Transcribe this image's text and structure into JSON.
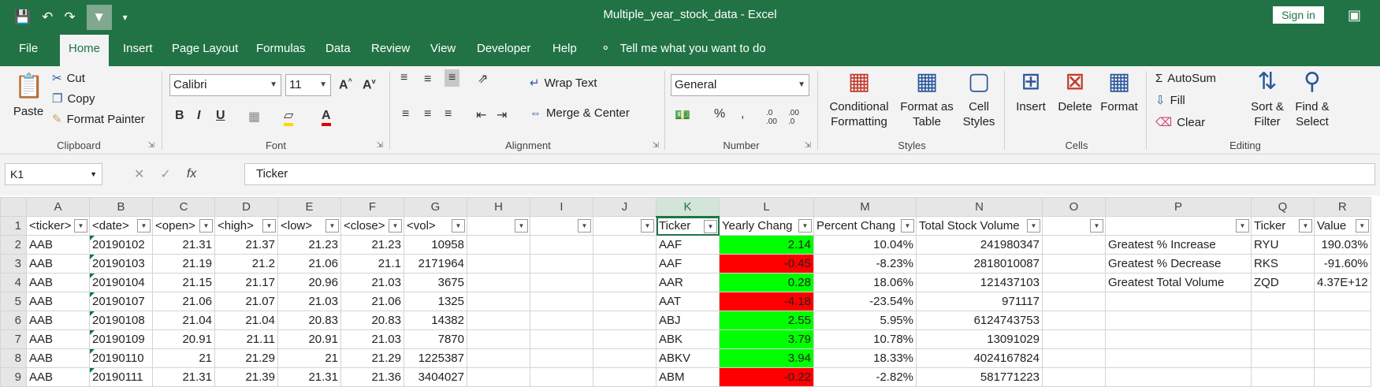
{
  "window": {
    "title": "Multiple_year_stock_data  -  Excel",
    "sign_in": "Sign in"
  },
  "ribbon_tabs": [
    "File",
    "Home",
    "Insert",
    "Page Layout",
    "Formulas",
    "Data",
    "Review",
    "View",
    "Developer",
    "Help"
  ],
  "tell_me": "Tell me what you want to do",
  "clipboard": {
    "paste": "Paste",
    "cut": "Cut",
    "copy": "Copy",
    "format_painter": "Format Painter",
    "label": "Clipboard"
  },
  "font": {
    "name": "Calibri",
    "size": "11",
    "label": "Font"
  },
  "alignment": {
    "wrap_text": "Wrap Text",
    "merge_center": "Merge & Center",
    "label": "Alignment"
  },
  "number": {
    "format": "General",
    "label": "Number"
  },
  "styles": {
    "conditional": "Conditional",
    "formatting": "Formatting",
    "format_as": "Format as",
    "table": "Table",
    "cell": "Cell",
    "styles": "Styles",
    "label": "Styles"
  },
  "cells": {
    "insert": "Insert",
    "delete": "Delete",
    "format": "Format",
    "label": "Cells"
  },
  "editing": {
    "autosum": "AutoSum",
    "fill": "Fill",
    "clear": "Clear",
    "sort": "Sort &",
    "filter": "Filter",
    "find": "Find &",
    "select": "Select",
    "label": "Editing"
  },
  "formula_bar": {
    "name_box": "K1",
    "formula": "Ticker"
  },
  "columns": [
    "A",
    "B",
    "C",
    "D",
    "E",
    "F",
    "G",
    "H",
    "I",
    "J",
    "K",
    "L",
    "M",
    "N",
    "O",
    "P",
    "Q",
    "R"
  ],
  "header_row": [
    "<ticker>",
    "<date>",
    "<open>",
    "<high>",
    "<low>",
    "<close>",
    "<vol>",
    "",
    "",
    "",
    "Ticker",
    "Yearly Chang",
    "Percent Chang",
    "Total Stock Volume",
    "",
    "",
    "Ticker",
    "Value"
  ],
  "rows": [
    {
      "n": "2",
      "A": "AAB",
      "B": "20190102",
      "C": "21.31",
      "D": "21.37",
      "E": "21.23",
      "F": "21.23",
      "G": "10958",
      "K": "AAF",
      "L": "2.14",
      "Lc": "pos",
      "M": "10.04%",
      "N": "241980347",
      "P": "Greatest % Increase",
      "Q": "RYU",
      "R": "190.03%"
    },
    {
      "n": "3",
      "A": "AAB",
      "B": "20190103",
      "C": "21.19",
      "D": "21.2",
      "E": "21.06",
      "F": "21.1",
      "G": "2171964",
      "K": "AAF",
      "L": "-0.45",
      "Lc": "neg",
      "M": "-8.23%",
      "N": "2818010087",
      "P": "Greatest % Decrease",
      "Q": "RKS",
      "R": "-91.60%"
    },
    {
      "n": "4",
      "A": "AAB",
      "B": "20190104",
      "C": "21.15",
      "D": "21.17",
      "E": "20.96",
      "F": "21.03",
      "G": "3675",
      "K": "AAR",
      "L": "0.28",
      "Lc": "pos",
      "M": "18.06%",
      "N": "121437103",
      "P": "Greatest Total Volume",
      "Q": "ZQD",
      "R": "4.37E+12"
    },
    {
      "n": "5",
      "A": "AAB",
      "B": "20190107",
      "C": "21.06",
      "D": "21.07",
      "E": "21.03",
      "F": "21.06",
      "G": "1325",
      "K": "AAT",
      "L": "-4.18",
      "Lc": "neg",
      "M": "-23.54%",
      "N": "971117",
      "P": "",
      "Q": "",
      "R": ""
    },
    {
      "n": "6",
      "A": "AAB",
      "B": "20190108",
      "C": "21.04",
      "D": "21.04",
      "E": "20.83",
      "F": "20.83",
      "G": "14382",
      "K": "ABJ",
      "L": "2.55",
      "Lc": "pos",
      "M": "5.95%",
      "N": "6124743753",
      "P": "",
      "Q": "",
      "R": ""
    },
    {
      "n": "7",
      "A": "AAB",
      "B": "20190109",
      "C": "20.91",
      "D": "21.11",
      "E": "20.91",
      "F": "21.03",
      "G": "7870",
      "K": "ABK",
      "L": "3.79",
      "Lc": "pos",
      "M": "10.78%",
      "N": "13091029",
      "P": "",
      "Q": "",
      "R": ""
    },
    {
      "n": "8",
      "A": "AAB",
      "B": "20190110",
      "C": "21",
      "D": "21.29",
      "E": "21",
      "F": "21.29",
      "G": "1225387",
      "K": "ABKV",
      "L": "3.94",
      "Lc": "pos",
      "M": "18.33%",
      "N": "4024167824",
      "P": "",
      "Q": "",
      "R": ""
    },
    {
      "n": "9",
      "A": "AAB",
      "B": "20190111",
      "C": "21.31",
      "D": "21.39",
      "E": "21.31",
      "F": "21.36",
      "G": "3404027",
      "K": "ABM",
      "L": "-0.22",
      "Lc": "neg",
      "M": "-2.82%",
      "N": "581771223",
      "P": "",
      "Q": "",
      "R": ""
    }
  ],
  "colors": {
    "excel_green": "#217346",
    "positive": "#00ff00",
    "negative": "#ff0000"
  }
}
